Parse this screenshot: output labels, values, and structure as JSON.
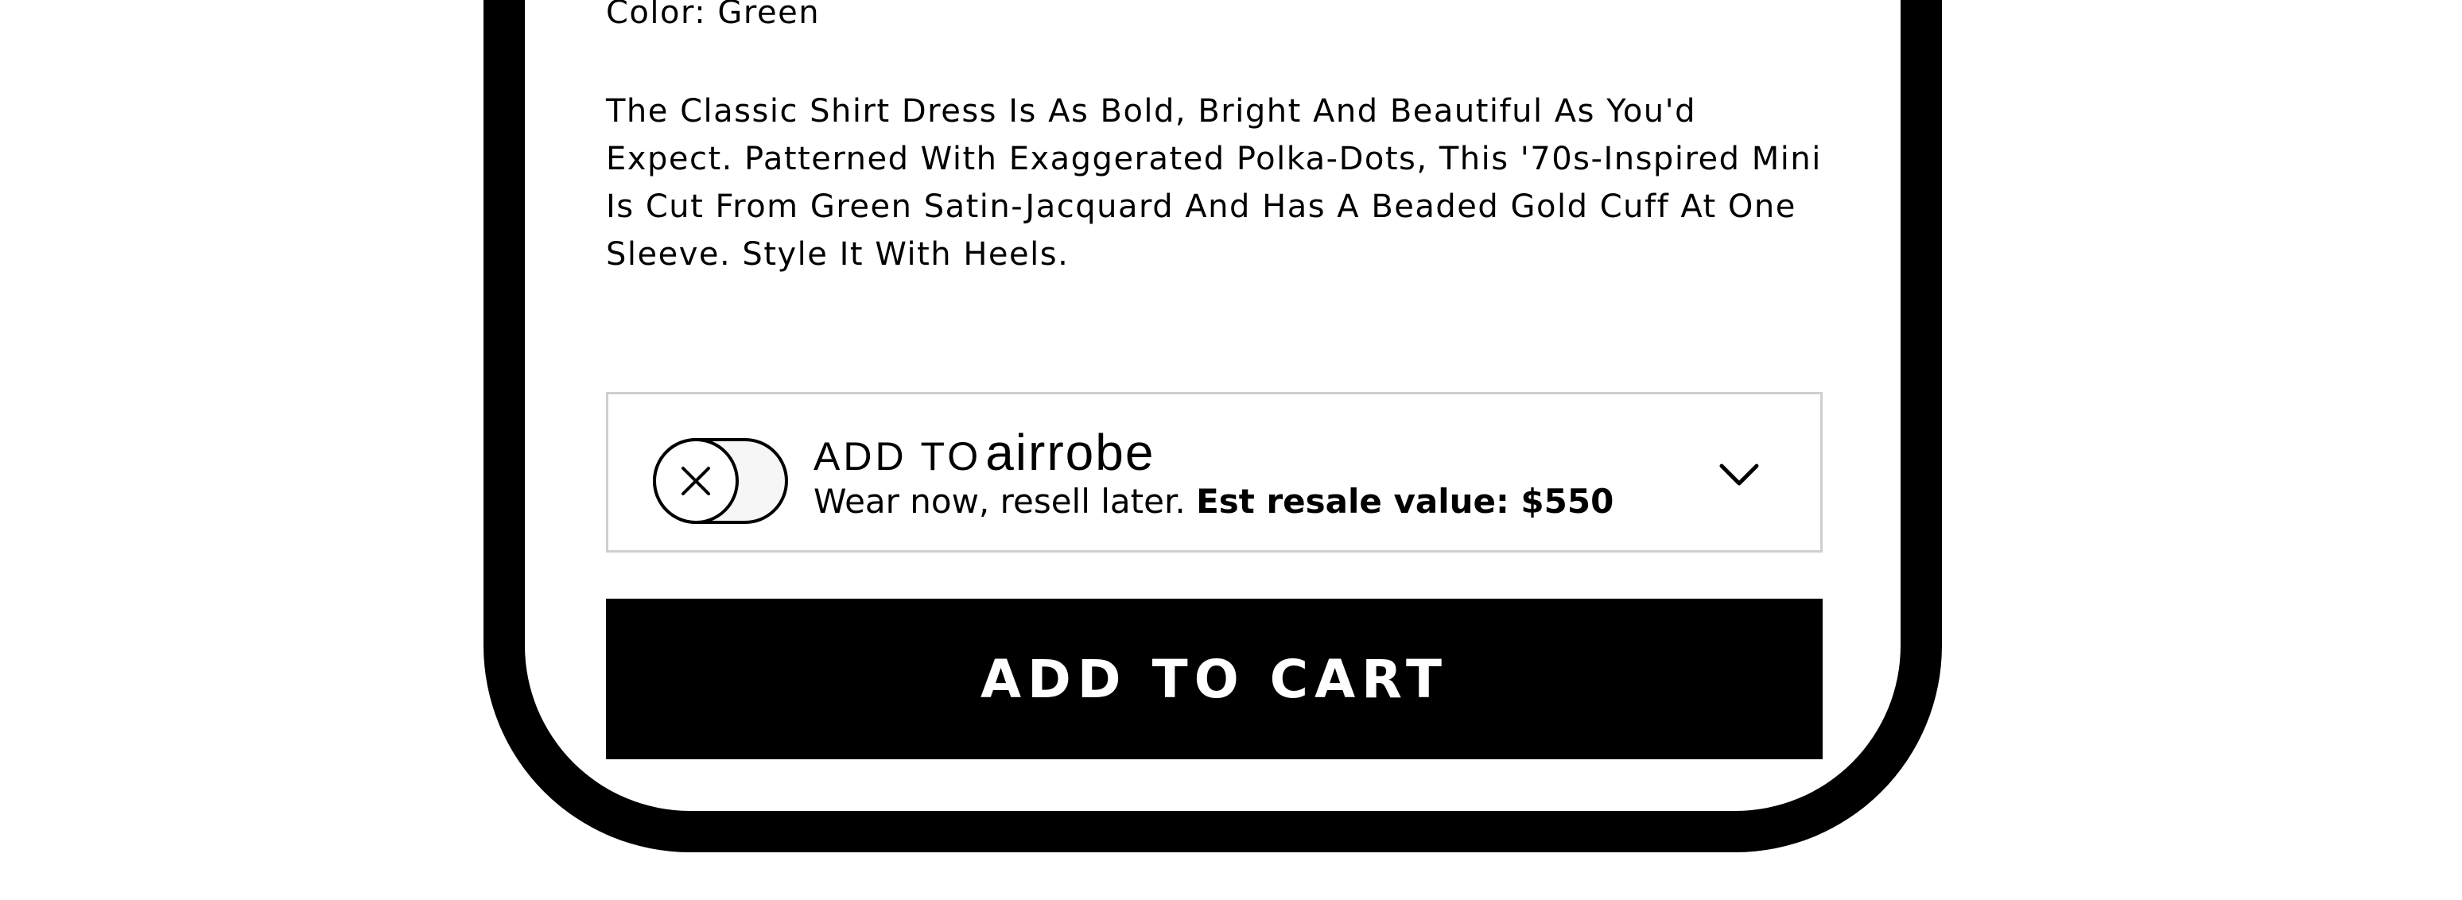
{
  "product": {
    "color_label": "Color: Green",
    "description": "The Classic Shirt Dress Is As Bold, Bright And Beautiful As You'd Expect. Patterned With Exaggerated Polka-Dots, This '70s-Inspired Mini Is Cut From Green Satin-Jacquard And Has A Beaded Gold Cuff At One Sleeve. Style It With Heels."
  },
  "airrobe": {
    "headline_prefix": "ADD TO",
    "brand": "airrobe",
    "tagline": "Wear now, resell later.",
    "resale_value": "Est resale value: $550",
    "toggle_on": false,
    "toggle_icon": "close-icon",
    "expand_icon": "chevron-down-icon"
  },
  "cart": {
    "button_label": "ADD TO CART"
  },
  "colors": {
    "frame": "#000000",
    "box_border": "#cfcfcf",
    "button_bg": "#000000",
    "button_text": "#ffffff"
  }
}
